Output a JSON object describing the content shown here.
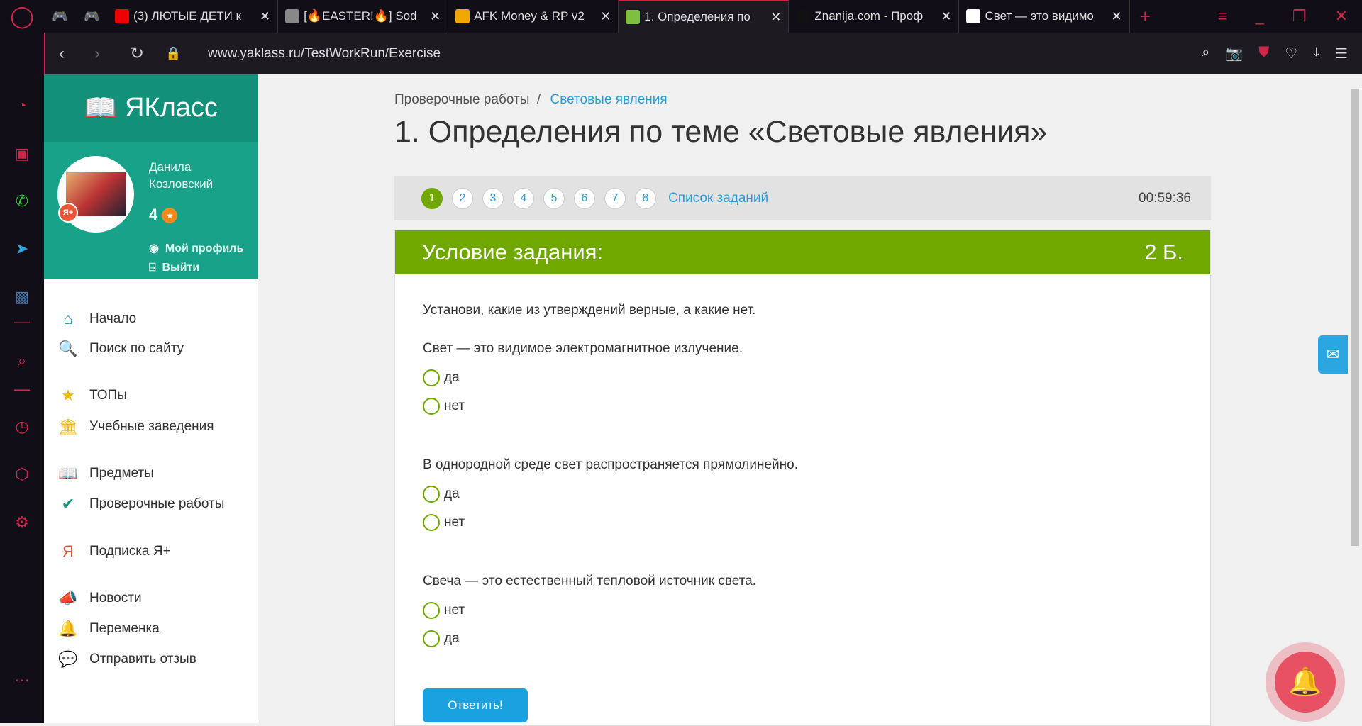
{
  "browser": {
    "tabs": [
      {
        "title": "(3) ЛЮТЫЕ ДЕТИ к",
        "color": "#e00"
      },
      {
        "title": "[🔥EASTER!🔥] Sod",
        "color": "#888"
      },
      {
        "title": "AFK Money & RP v2",
        "color": "#f0a800"
      },
      {
        "title": "1. Определения по",
        "color": "#7fbf3f",
        "active": true
      },
      {
        "title": "Znanija.com - Проф",
        "color": "#111"
      },
      {
        "title": "Свет — это видимо",
        "color": "#fff"
      }
    ],
    "url": "www.yaklass.ru/TestWorkRun/Exercise"
  },
  "site": {
    "logo": "ЯКласс",
    "user": {
      "first": "Данила",
      "last": "Козловский",
      "score": "4",
      "badge": "Я+",
      "profile": "Мой профиль",
      "logout": "Выйти"
    },
    "menu": [
      {
        "label": "Начало",
        "icon": "⌂",
        "color": "#1aa1b0"
      },
      {
        "label": "Поиск по сайту",
        "icon": "🔍",
        "color": "#1aa1b0"
      },
      {
        "label": "ТОПы",
        "icon": "★",
        "color": "#f5b800"
      },
      {
        "label": "Учебные заведения",
        "icon": "🏛",
        "color": "#f5b800"
      },
      {
        "label": "Предметы",
        "icon": "📖",
        "color": "#139079"
      },
      {
        "label": "Проверочные работы",
        "icon": "✔",
        "color": "#139079"
      },
      {
        "label": "Подписка Я+",
        "icon": "Я",
        "color": "#e8573a"
      },
      {
        "label": "Новости",
        "icon": "📣",
        "color": "#456"
      },
      {
        "label": "Переменка",
        "icon": "🔔",
        "color": "#456"
      },
      {
        "label": "Отправить отзыв",
        "icon": "💬",
        "color": "#456"
      }
    ]
  },
  "main": {
    "breadcrumb": [
      "Проверочные работы",
      "Световые явления"
    ],
    "title": "1. Определения по теме «Световые явления»",
    "questions": [
      "1",
      "2",
      "3",
      "4",
      "5",
      "6",
      "7",
      "8"
    ],
    "task_list": "Список заданий",
    "timer": "00:59:36",
    "header": "Условие задания:",
    "points": "2 Б.",
    "instruction": "Установи, какие из утверждений верные, а какие нет.",
    "statements": [
      {
        "text": "Свет — это видимое электромагнитное излучение.",
        "options": [
          "да",
          "нет"
        ]
      },
      {
        "text": "В однородной среде свет распространяется прямолинейно.",
        "options": [
          "да",
          "нет"
        ]
      },
      {
        "text": "Свеча — это естественный тепловой источник света.",
        "options": [
          "нет",
          "да"
        ]
      }
    ],
    "submit": "Ответить!"
  }
}
